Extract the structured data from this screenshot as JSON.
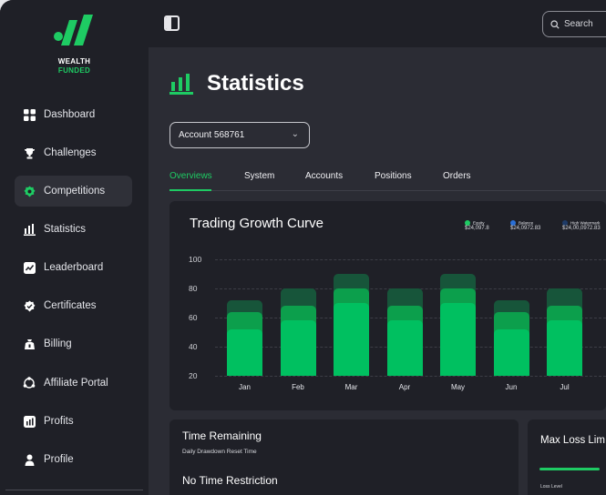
{
  "brand": {
    "line1": "WEALTH",
    "line2": "FUNDED"
  },
  "sidebar": {
    "items": [
      {
        "label": "Dashboard",
        "icon": "grid-icon"
      },
      {
        "label": "Challenges",
        "icon": "trophy-icon"
      },
      {
        "label": "Competitions",
        "icon": "badge-icon",
        "active": true
      },
      {
        "label": "Statistics",
        "icon": "bar-chart-icon"
      },
      {
        "label": "Leaderboard",
        "icon": "leaderboard-icon"
      },
      {
        "label": "Certificates",
        "icon": "certificate-icon"
      },
      {
        "label": "Billing",
        "icon": "wallet-icon"
      },
      {
        "label": "Affiliate Portal",
        "icon": "affiliate-icon"
      },
      {
        "label": "Profits",
        "icon": "profits-icon"
      },
      {
        "label": "Profile",
        "icon": "user-icon"
      }
    ]
  },
  "topbar": {
    "search_label": "Search"
  },
  "page": {
    "title": "Statistics"
  },
  "account_select": {
    "value": "Account 568761"
  },
  "tabs": [
    "Overviews",
    "System",
    "Accounts",
    "Positions",
    "Orders"
  ],
  "chart_card": {
    "title": "Trading Growth Curve",
    "legend": [
      {
        "name": "Equity",
        "value": "$24,097.8",
        "color": "#1ecb63"
      },
      {
        "name": "Balance",
        "value": "$24,0972.83",
        "color": "#2a6fd6"
      },
      {
        "name": "High Watermark",
        "value": "$24,00,0972.83",
        "color": "#1e3a66"
      }
    ]
  },
  "chart_data": {
    "type": "bar",
    "stacked": true,
    "categories": [
      "Jan",
      "Feb",
      "Mar",
      "Apr",
      "May",
      "Jun",
      "Jul"
    ],
    "yticks": [
      100,
      80,
      60,
      40,
      20
    ],
    "ylim": [
      20,
      100
    ],
    "grid": true,
    "series": [
      {
        "name": "Equity",
        "values": [
          52,
          58,
          70,
          58,
          70,
          52,
          58
        ],
        "color": "#00c060"
      },
      {
        "name": "Balance",
        "values": [
          64,
          68,
          80,
          68,
          80,
          64,
          68
        ],
        "color": "#0c9f4c"
      },
      {
        "name": "High Watermark",
        "values": [
          72,
          80,
          90,
          80,
          90,
          72,
          80
        ],
        "color": "#17553a"
      }
    ]
  },
  "time_card": {
    "title": "Time Remaining",
    "subtitle": "Daily Drawdown Reset Time",
    "status": "No Time Restriction"
  },
  "loss_card": {
    "title": "Max Loss Lim",
    "sub_label": "Loss Level"
  }
}
